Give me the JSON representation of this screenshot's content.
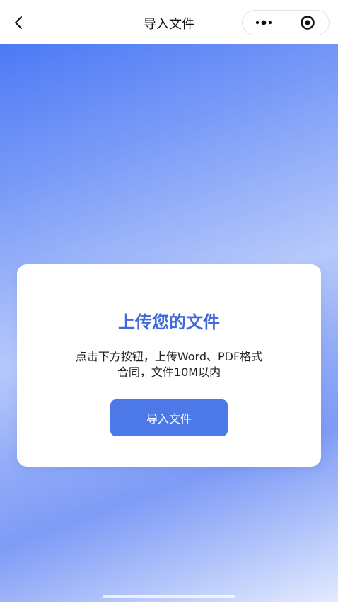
{
  "navbar": {
    "title": "导入文件",
    "icons": {
      "back": "chevron-left-icon",
      "more": "more-dots-icon",
      "close": "target-circle-icon"
    }
  },
  "card": {
    "title": "上传您的文件",
    "description_line1": "点击下方按钮，上传Word、PDF格式",
    "description_line2": "合同，文件10M以内",
    "button_label": "导入文件"
  },
  "colors": {
    "accent": "#4c78e8",
    "title": "#3f6ad8",
    "gradient_start": "#4c79f6",
    "gradient_end": "#e4ebff"
  }
}
